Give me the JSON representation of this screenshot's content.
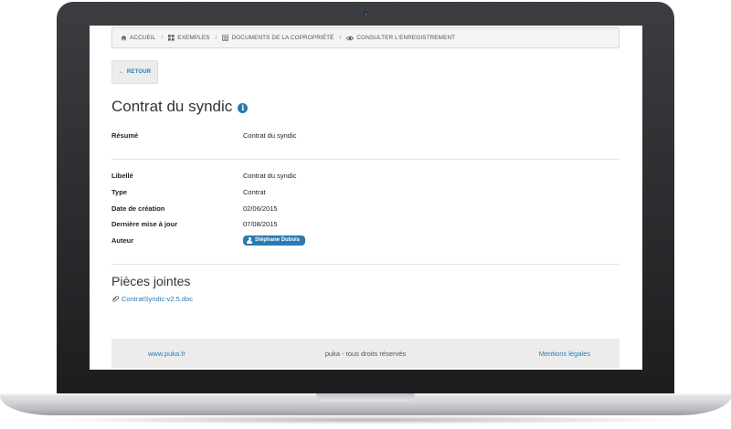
{
  "breadcrumb": {
    "items": [
      {
        "label": "ACCUEIL",
        "icon": "home-icon"
      },
      {
        "label": "EXEMPLES",
        "icon": "grid-icon"
      },
      {
        "label": "DOCUMENTS DE LA COPROPRIÉTÉ",
        "icon": "folder-icon"
      },
      {
        "label": "CONSULTER L'ENREGISTREMENT",
        "icon": "eye-icon"
      }
    ],
    "separator": "/"
  },
  "back_button": {
    "label": "RETOUR",
    "icon": "arrow-left-icon"
  },
  "page": {
    "title": "Contrat du syndic",
    "info_icon": "info-icon"
  },
  "summary": {
    "label": "Résumé",
    "value": "Contrat du syndic"
  },
  "details": [
    {
      "label": "Libellé",
      "value": "Contrat du syndic"
    },
    {
      "label": "Type",
      "value": "Contrat"
    },
    {
      "label": "Date de création",
      "value": "02/06/2015"
    },
    {
      "label": "Dernière mise à jour",
      "value": "07/08/2015"
    },
    {
      "label": "Auteur",
      "value": "Stéphane Dubois"
    }
  ],
  "attachments": {
    "title": "Pièces jointes",
    "files": [
      {
        "name": "ContratSyndic-v2.5.doc",
        "icon": "paperclip-icon"
      }
    ]
  },
  "footer": {
    "left_link": "www.puka.fr",
    "center_text": "puka - tous droits réservés",
    "right_link": "Mentions légales"
  },
  "colors": {
    "accent": "#2a7ab0",
    "breadcrumb_bg": "#f4f4f4",
    "footer_bg": "#ececec"
  }
}
